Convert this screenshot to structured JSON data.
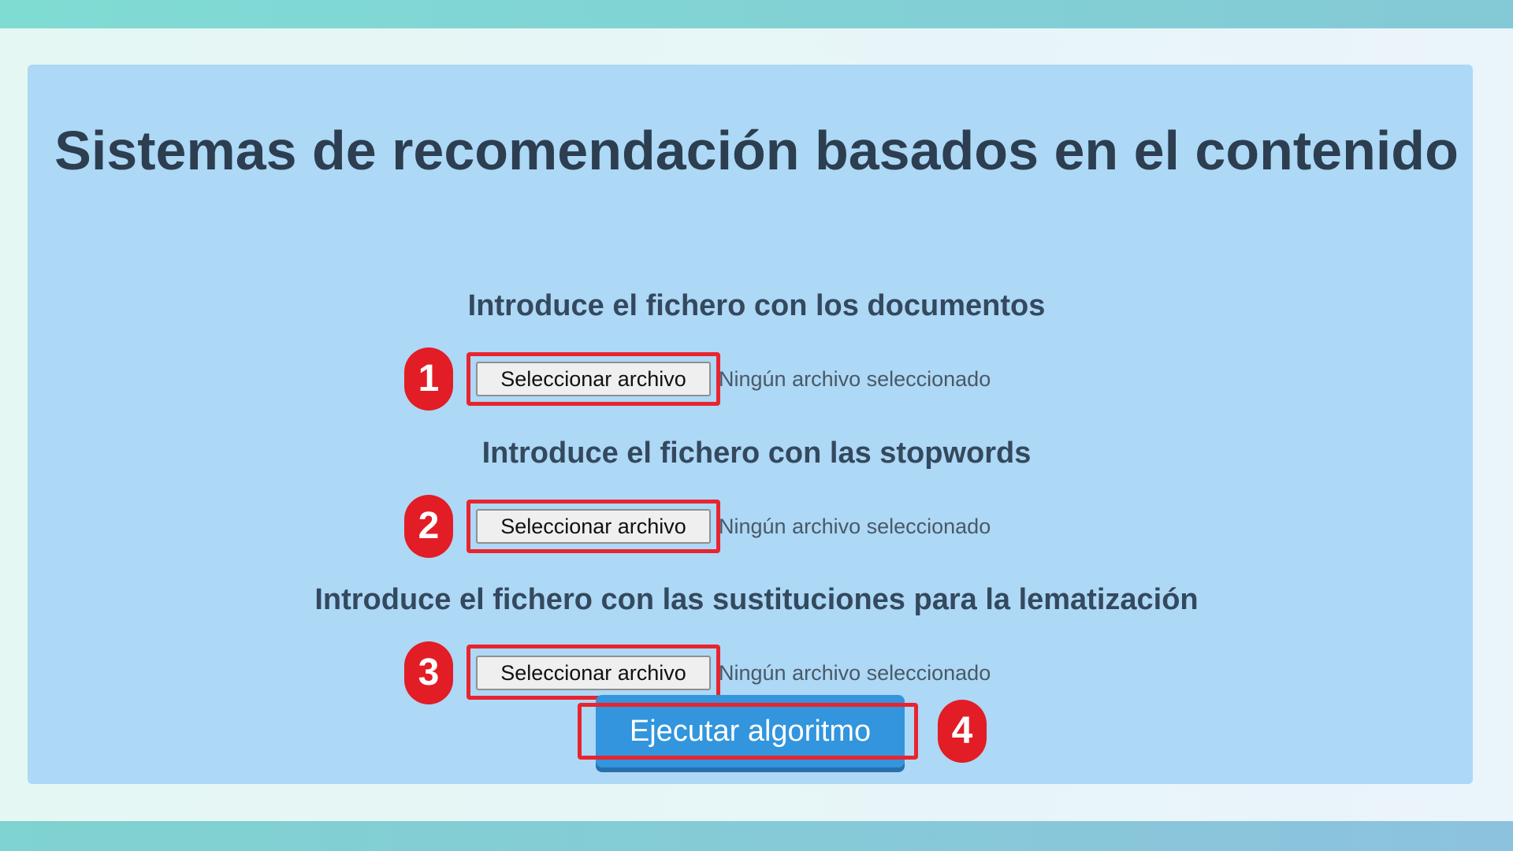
{
  "page": {
    "title": "Sistemas de recomendación basados en el contenido",
    "sections": [
      {
        "label": "Introduce el fichero con los documentos",
        "button_label": "Seleccionar archivo",
        "status": "Ningún archivo seleccionado",
        "marker": "1"
      },
      {
        "label": "Introduce el fichero con las stopwords",
        "button_label": "Seleccionar archivo",
        "status": "Ningún archivo seleccionado",
        "marker": "2"
      },
      {
        "label": "Introduce el fichero con las sustituciones para la lematización",
        "button_label": "Seleccionar archivo",
        "status": "Ningún archivo seleccionado",
        "marker": "3"
      }
    ],
    "run_button": {
      "label": "Ejecutar algoritmo",
      "marker": "4"
    }
  },
  "colors": {
    "card_background": "#add8f6",
    "heading_text": "#2c3e50",
    "run_button": "#3295dd",
    "annotation_red": "#e21d26"
  }
}
